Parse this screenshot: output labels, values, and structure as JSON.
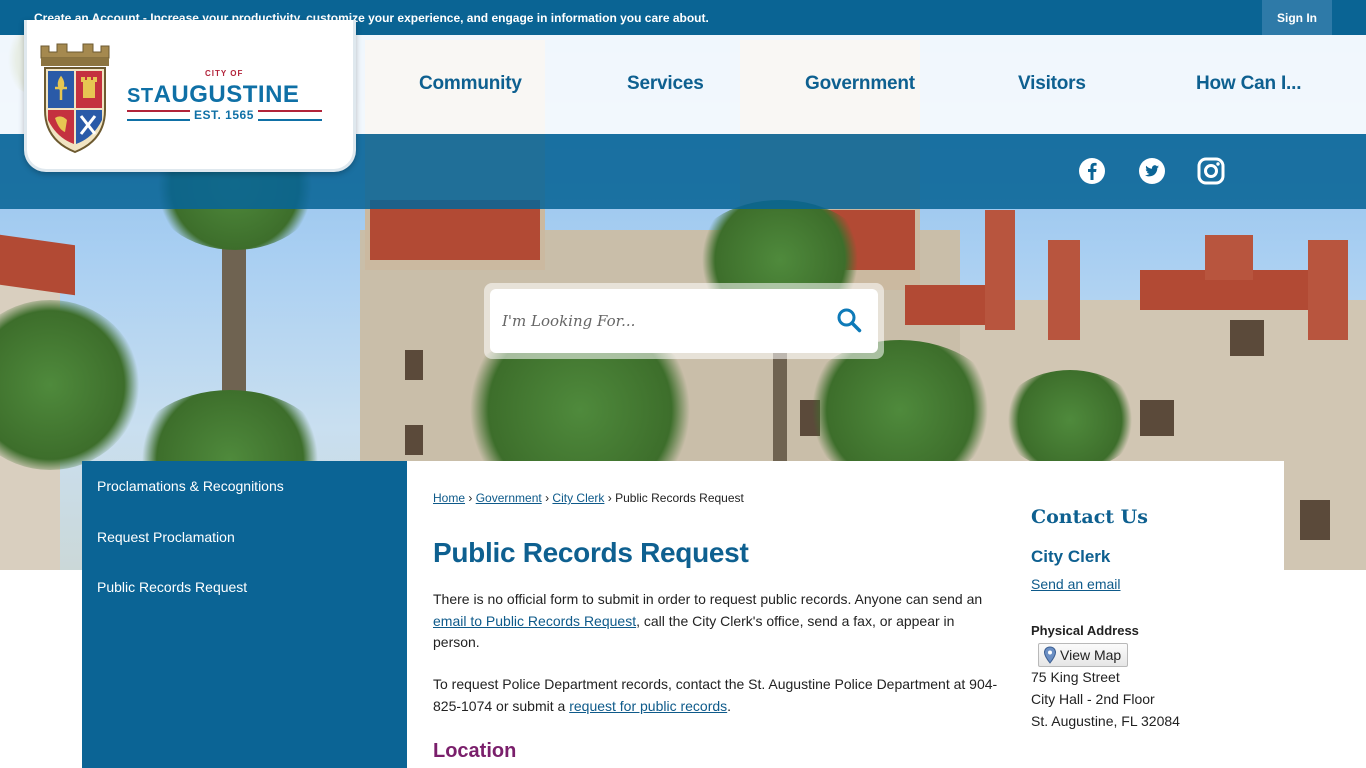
{
  "topbar": {
    "message": "Create an Account - Increase your productivity, customize your experience, and engage in information you care about.",
    "signin": "Sign In"
  },
  "logo": {
    "city_of": "CITY OF",
    "st": "ST",
    "name": "AUGUSTINE",
    "est": "EST. 1565"
  },
  "nav": {
    "items": [
      "Community",
      "Services",
      "Government",
      "Visitors",
      "How Can I..."
    ]
  },
  "social": {
    "icons": [
      "facebook-icon",
      "twitter-icon",
      "instagram-icon"
    ]
  },
  "search": {
    "placeholder": "I'm Looking For..."
  },
  "sidebar": {
    "items": [
      "Proclamations & Recognitions",
      "Request Proclamation",
      "Public Records Request"
    ]
  },
  "breadcrumb": {
    "home": "Home",
    "sep": "›",
    "government": "Government",
    "city_clerk": "City Clerk",
    "current": "Public Records Request"
  },
  "main": {
    "title": "Public Records Request",
    "p1_a": "There is no official form to submit in order to request public records. Anyone can send an ",
    "p1_link": "email to Public Records Request",
    "p1_b": ", call the City Clerk's office, send a fax, or appear in person.",
    "p2_a": "To request Police Department records, contact the St. Augustine Police Department at 904-825-1074 or submit a ",
    "p2_link": "request for public records",
    "p2_b": ".",
    "location": "Location"
  },
  "contact": {
    "heading": "Contact Us",
    "dept": "City Clerk",
    "email_link": "Send an email",
    "physical_heading": "Physical Address",
    "view_map": "View Map",
    "address": [
      "75 King Street",
      "City Hall - 2nd Floor",
      "St. Augustine, FL 32084"
    ]
  },
  "colors": {
    "brand_blue": "#0a6494",
    "link_blue": "#0e5a8a",
    "heading_purple": "#7a1f6b",
    "logo_red": "#b2233a"
  }
}
